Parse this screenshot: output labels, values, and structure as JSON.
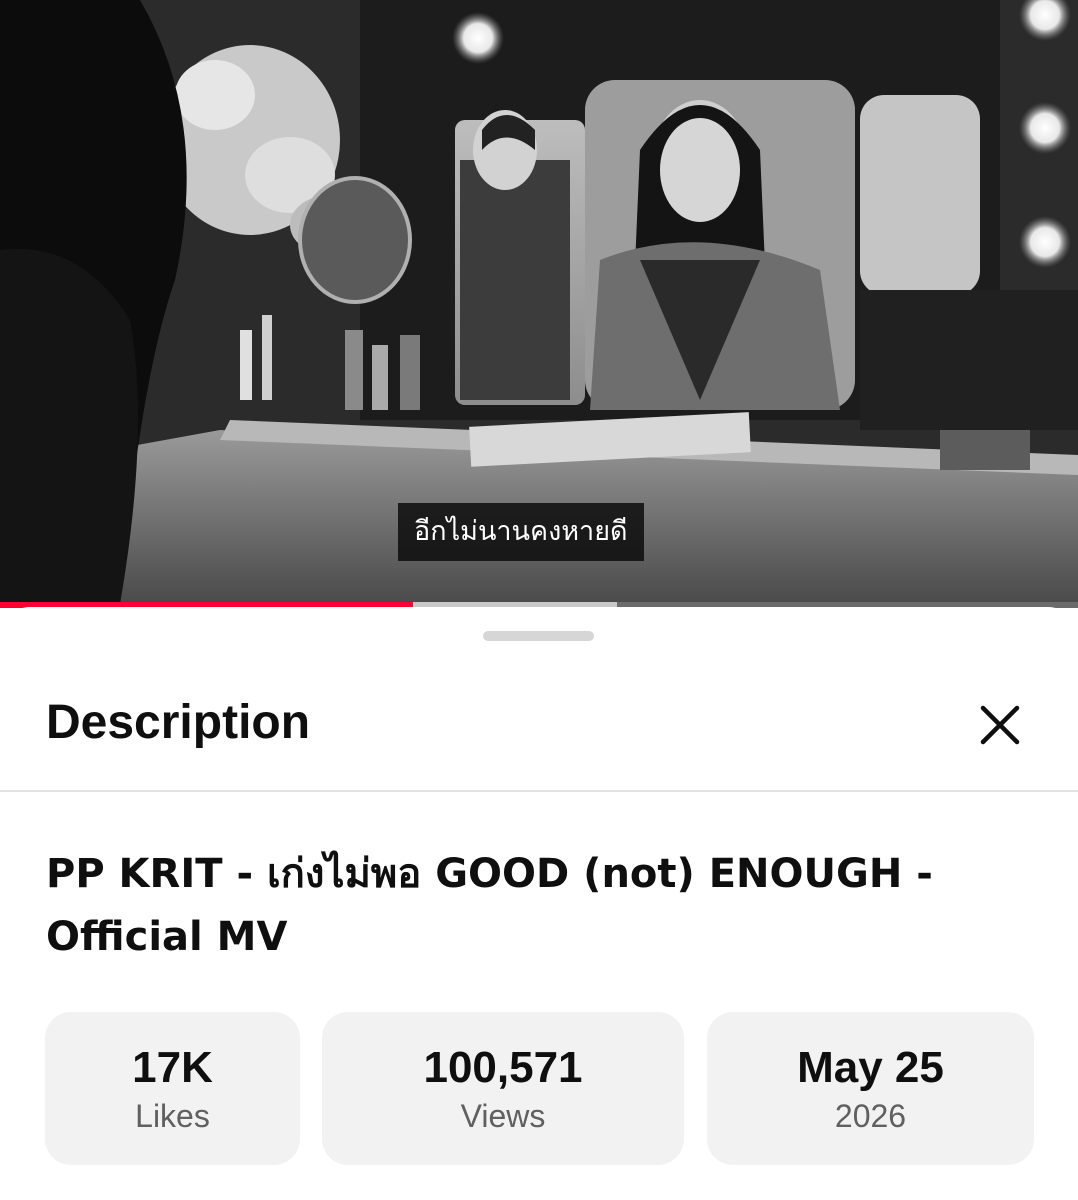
{
  "video": {
    "subtitle": "อีกไม่นานคงหายดี",
    "progress": {
      "played_fraction": 0.383,
      "buffered_fraction": 0.572
    }
  },
  "sheet": {
    "title": "Description",
    "close_icon": "close-icon"
  },
  "details": {
    "title": "PP KRIT - เก่งไม่พอ GOOD (not) ENOUGH - Official MV",
    "stats": {
      "likes": {
        "value": "17K",
        "label": "Likes"
      },
      "views": {
        "value": "100,571",
        "label": "Views"
      },
      "date": {
        "value": "May 25",
        "label": "2026"
      }
    }
  },
  "colors": {
    "progress_played": "#ff0033",
    "progress_buffered": "#c8c8c8",
    "stat_card_bg": "#f2f2f2"
  }
}
